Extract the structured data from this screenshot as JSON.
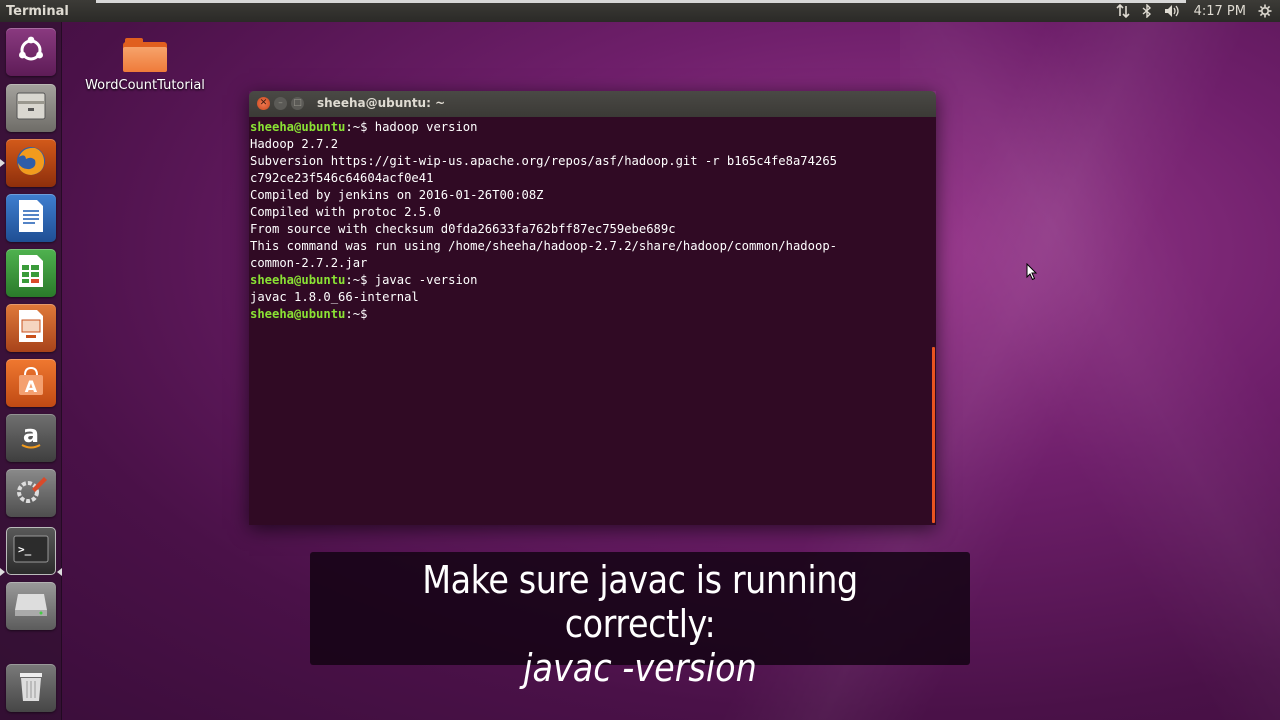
{
  "top_panel": {
    "app_title": "Terminal",
    "clock": "4:17 PM",
    "indicators": [
      "network-icon",
      "bluetooth-icon",
      "volume-icon",
      "gear-icon"
    ]
  },
  "launcher": {
    "items": [
      {
        "name": "ubuntu-dash",
        "icon": "ubuntu-logo-icon",
        "color": "#7a2c6e"
      },
      {
        "name": "files",
        "icon": "file-cabinet-icon",
        "color": "#8a8a85"
      },
      {
        "name": "firefox",
        "icon": "firefox-icon",
        "color": "#e66000"
      },
      {
        "name": "libreoffice-writer",
        "icon": "writer-icon",
        "color": "#2a66b8"
      },
      {
        "name": "libreoffice-calc",
        "icon": "calc-icon",
        "color": "#3a9b3a"
      },
      {
        "name": "libreoffice-impress",
        "icon": "impress-icon",
        "color": "#c8511c"
      },
      {
        "name": "ubuntu-software",
        "icon": "shopping-bag-icon",
        "color": "#e05a1c"
      },
      {
        "name": "amazon",
        "icon": "amazon-icon",
        "color": "#555555"
      },
      {
        "name": "system-settings",
        "icon": "settings-wrench-icon",
        "color": "#707070"
      },
      {
        "name": "terminal",
        "icon": "terminal-icon",
        "color": "#3b3b3b"
      },
      {
        "name": "drive",
        "icon": "drive-icon",
        "color": "#808080"
      },
      {
        "name": "trash",
        "icon": "trash-icon",
        "color": "#606060"
      }
    ],
    "glyphs": {
      "amazon": "a",
      "writer": "",
      "terminal": ">_",
      "software": "A"
    }
  },
  "desktop": {
    "folder_label": "WordCountTutorial"
  },
  "terminal": {
    "title": "sheeha@ubuntu: ~",
    "lines": [
      {
        "prompt": "sheeha@ubuntu",
        "path": ":~$ ",
        "text": "hadoop version"
      },
      {
        "text": "Hadoop 2.7.2"
      },
      {
        "text": "Subversion https://git-wip-us.apache.org/repos/asf/hadoop.git -r b165c4fe8a74265"
      },
      {
        "text": "c792ce23f546c64604acf0e41"
      },
      {
        "text": "Compiled by jenkins on 2016-01-26T00:08Z"
      },
      {
        "text": "Compiled with protoc 2.5.0"
      },
      {
        "text": "From source with checksum d0fda26633fa762bff87ec759ebe689c"
      },
      {
        "text": "This command was run using /home/sheeha/hadoop-2.7.2/share/hadoop/common/hadoop-"
      },
      {
        "text": "common-2.7.2.jar"
      },
      {
        "prompt": "sheeha@ubuntu",
        "path": ":~$ ",
        "text": "javac -version"
      },
      {
        "text": "javac 1.8.0_66-internal"
      },
      {
        "prompt": "sheeha@ubuntu",
        "path": ":~$ ",
        "text": ""
      }
    ]
  },
  "caption": {
    "line1": "Make sure javac is running correctly:",
    "line2": "javac -version"
  }
}
